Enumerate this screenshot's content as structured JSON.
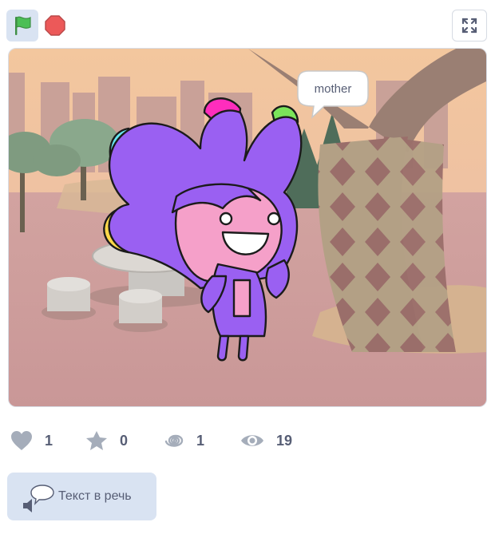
{
  "toolbar": {
    "icons": [
      "green-flag-icon",
      "stop-icon",
      "fullscreen-icon"
    ]
  },
  "stage": {
    "speech_bubble": "mother"
  },
  "stats": {
    "likes": "1",
    "favorites": "0",
    "remixes": "1",
    "views": "19"
  },
  "extension": {
    "label": "Текст в речь",
    "icon": "text-to-speech-icon"
  },
  "colors": {
    "accent_bg": "#d9e3f2",
    "flag_green": "#4cbf56",
    "stop_red": "#ec5959",
    "text": "#575e75",
    "stat_icon": "#a5adba"
  }
}
